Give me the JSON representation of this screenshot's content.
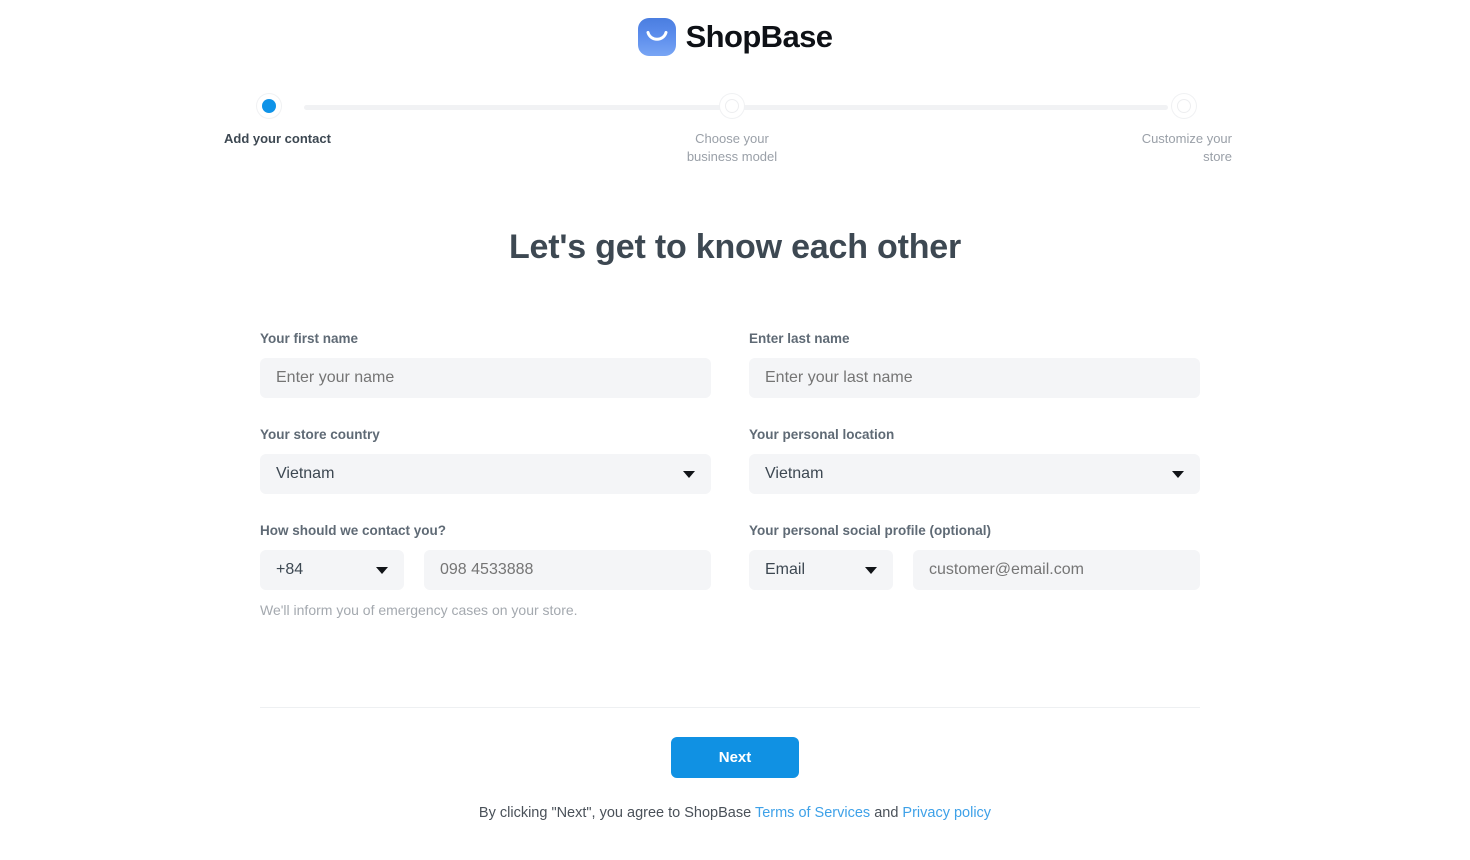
{
  "brand": {
    "name": "ShopBase",
    "logo_icon": "shopbase-smile-icon",
    "accent_color": "#1091e3",
    "logo_color": "#5b8cec"
  },
  "stepper": {
    "steps": [
      {
        "label": "Add your contact",
        "state": "active"
      },
      {
        "label": "Choose your\nbusiness model",
        "line1": "Choose your",
        "line2": "business model",
        "state": "inactive"
      },
      {
        "label": "Customize your\nstore",
        "line1": "Customize your",
        "line2": "store",
        "state": "inactive"
      }
    ]
  },
  "heading": "Let's get to know each other",
  "form": {
    "first_name": {
      "label": "Your first name",
      "placeholder": "Enter your name",
      "value": ""
    },
    "last_name": {
      "label": "Enter last name",
      "placeholder": "Enter your last name",
      "value": ""
    },
    "store_country": {
      "label": "Your store country",
      "value": "Vietnam"
    },
    "personal_location": {
      "label": "Your personal location",
      "value": "Vietnam"
    },
    "contact": {
      "label": "How should we contact you?",
      "dial_code": "+84",
      "phone_placeholder": "098 4533888",
      "phone_value": "",
      "helper": "We'll inform you of emergency cases on your store."
    },
    "social_profile": {
      "label": "Your personal social profile (optional)",
      "channel": "Email",
      "placeholder": "customer@email.com",
      "value": ""
    }
  },
  "footer": {
    "next_label": "Next",
    "terms_prefix": "By clicking \"Next\", you agree to ShopBase ",
    "terms_link": "Terms of Services",
    "terms_middle": " and ",
    "privacy_link": "Privacy policy"
  }
}
